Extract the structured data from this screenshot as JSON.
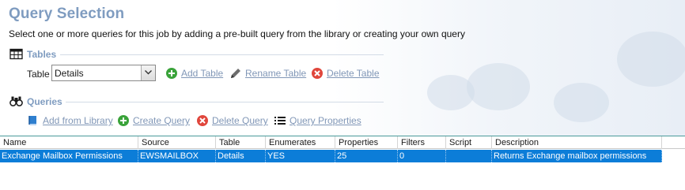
{
  "page": {
    "title": "Query Selection",
    "subtitle": "Select one or more queries for this job by adding a pre-built query from the library or creating your own query"
  },
  "tables_section": {
    "heading": "Tables",
    "table_label": "Table",
    "selected_table": "Details",
    "actions": {
      "add": "Add Table",
      "rename": "Rename Table",
      "delete": "Delete Table"
    }
  },
  "queries_section": {
    "heading": "Queries",
    "actions": {
      "add_from_library": "Add from Library",
      "create": "Create Query",
      "delete": "Delete Query",
      "properties": "Query Properties"
    }
  },
  "grid": {
    "columns": [
      "Name",
      "Source",
      "Table",
      "Enumerates",
      "Properties",
      "Filters",
      "Script",
      "Description"
    ],
    "rows": [
      {
        "name": "Exchange Mailbox Permissions",
        "source": "EWSMAILBOX",
        "table": "Details",
        "enumerates": "YES",
        "properties": "25",
        "filters": "0",
        "script": "",
        "description": "Returns Exchange mailbox permissions",
        "selected": true
      }
    ]
  },
  "colors": {
    "heading_blue": "#7f9cc0",
    "link_blue": "#8197b7",
    "selection_blue": "#0c7dd8",
    "add_green": "#3aa33a",
    "delete_red": "#e0463c"
  },
  "icons": {
    "tables": "table-grid-icon",
    "queries": "binoculars-icon",
    "add": "plus-circle-icon",
    "rename": "pencil-icon",
    "delete": "x-circle-icon",
    "library": "book-icon",
    "properties": "list-icon"
  }
}
